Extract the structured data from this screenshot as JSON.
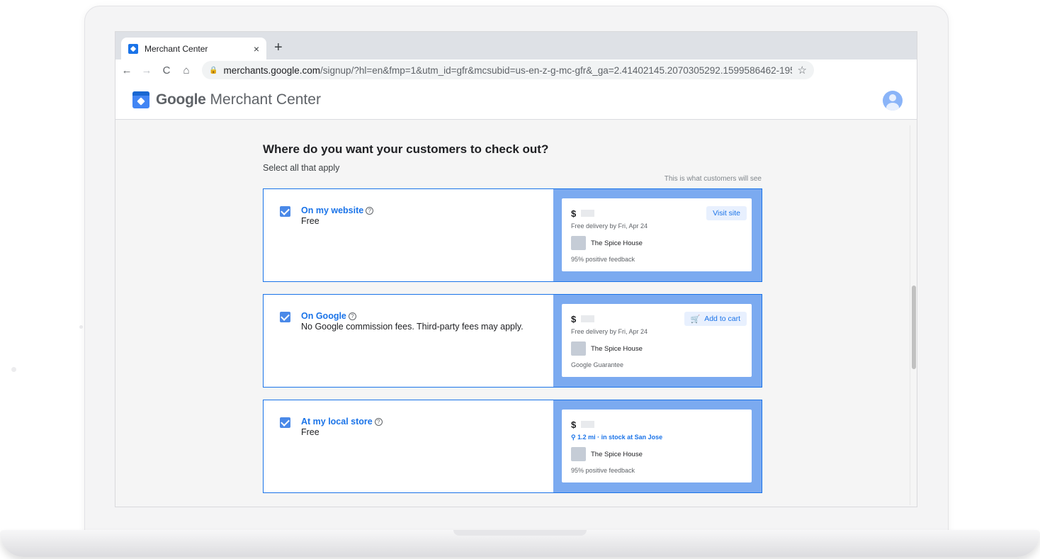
{
  "browser": {
    "tab_title": "Merchant Center",
    "tab_close": "×",
    "new_tab": "+",
    "nav_back": "←",
    "nav_forward": "→",
    "nav_reload": "C",
    "nav_home": "⌂",
    "lock": "🔒",
    "url_host": "merchants.google.com",
    "url_rest": "/signup/?hl=en&fmp=1&utm_id=gfr&mcsubid=us-en-z-g-mc-gfr&_ga=2.41402145.2070305292.1599586462-19541531...",
    "star": "☆"
  },
  "app": {
    "brand_google": "Google",
    "brand_product": "Merchant Center"
  },
  "page": {
    "heading": "Where do you want your customers to check out?",
    "subheading": "Select all that apply",
    "preview_note": "This is what customers will see"
  },
  "options": [
    {
      "title": "On my website",
      "description": "Free",
      "checked": true,
      "preview": {
        "price_symbol": "$",
        "line": "Free delivery by Fri, Apr 24",
        "store": "The Spice House",
        "footer": "95% positive feedback",
        "action": "Visit site"
      }
    },
    {
      "title": "On Google",
      "description": "No Google commission fees. Third-party fees may apply.",
      "checked": true,
      "preview": {
        "price_symbol": "$",
        "line": "Free delivery by Fri, Apr 24",
        "store": "The Spice House",
        "footer": "Google Guarantee",
        "action": "Add to cart"
      }
    },
    {
      "title": "At my local store",
      "description": "Free",
      "checked": true,
      "preview": {
        "price_symbol": "$",
        "line": "⚲ 1.2 mi · in stock at San Jose",
        "store": "The Spice House",
        "footer": "95% positive feedback"
      }
    }
  ],
  "icons": {
    "help": "?",
    "cart": "🛒"
  },
  "colors": {
    "accent": "#1a73e8",
    "preview_panel": "#7baaf0",
    "checkbox": "#4a89e8"
  }
}
